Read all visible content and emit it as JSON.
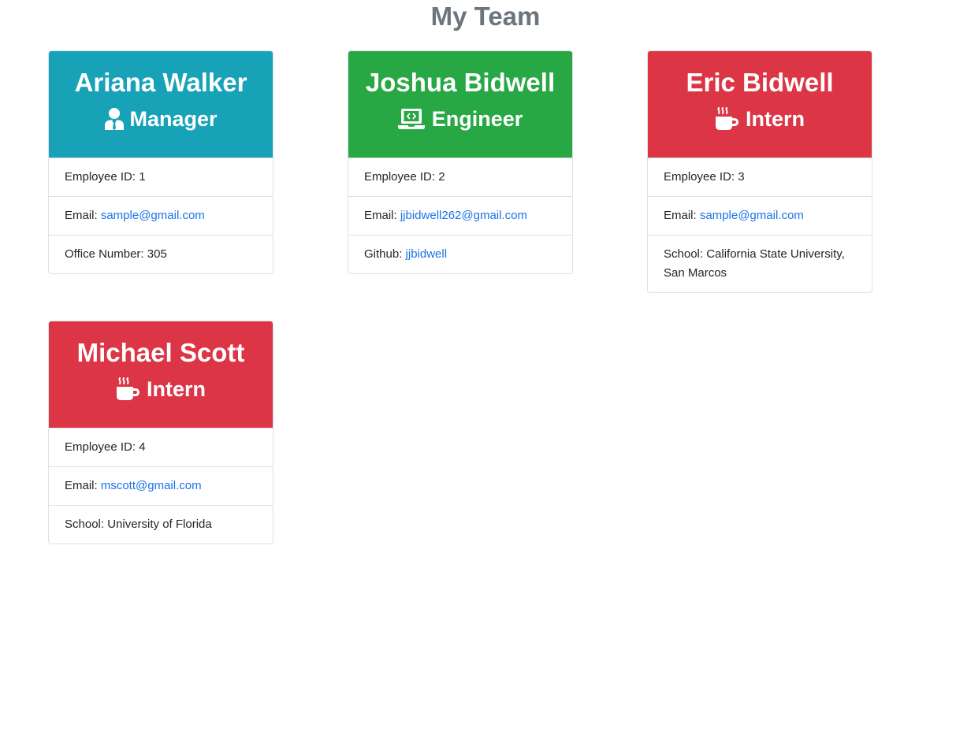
{
  "page_title": "My Team",
  "colors": {
    "manager": "#17a2b8",
    "engineer": "#28a745",
    "intern": "#dc3545",
    "link": "#1a73e8",
    "title": "#6c757d"
  },
  "employees": [
    {
      "name": "Ariana Walker",
      "role": "Manager",
      "role_icon": "user-tie-icon",
      "id_label": "Employee ID: 1",
      "email_label": "Email: ",
      "email": "sample@gmail.com",
      "extra_label": "Office Number: 305",
      "extra_link": ""
    },
    {
      "name": "Joshua Bidwell",
      "role": "Engineer",
      "role_icon": "laptop-code-icon",
      "id_label": "Employee ID: 2",
      "email_label": "Email: ",
      "email": "jjbidwell262@gmail.com",
      "extra_label": "Github: ",
      "extra_link": "jjbidwell"
    },
    {
      "name": "Eric Bidwell",
      "role": "Intern",
      "role_icon": "mug-hot-icon",
      "id_label": "Employee ID: 3",
      "email_label": "Email: ",
      "email": "sample@gmail.com",
      "extra_label": "School: California State University, San Marcos",
      "extra_link": ""
    },
    {
      "name": "Michael Scott",
      "role": "Intern",
      "role_icon": "mug-hot-icon",
      "id_label": "Employee ID: 4",
      "email_label": "Email: ",
      "email": "mscott@gmail.com",
      "extra_label": "School: University of Florida",
      "extra_link": ""
    }
  ]
}
